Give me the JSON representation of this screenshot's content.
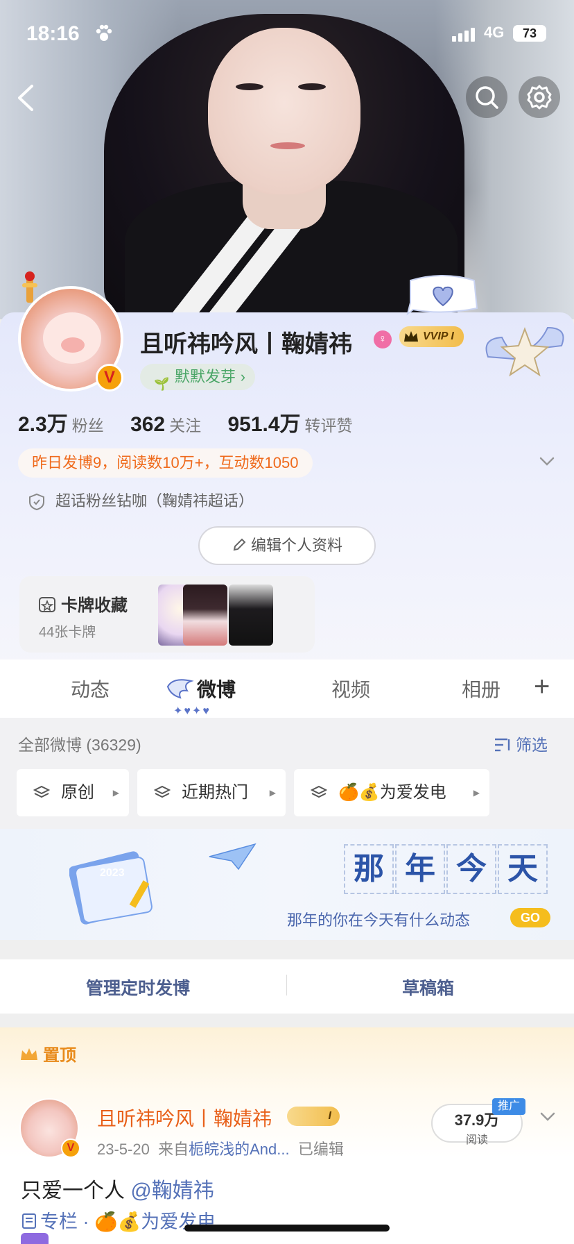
{
  "status": {
    "time": "18:16",
    "network": "4G",
    "battery": "73"
  },
  "profile": {
    "name": "且听祎吟风丨鞠婧祎",
    "vip_label": "VVIP I",
    "sprout_label": "默默发芽",
    "stats": [
      {
        "value": "2.3万",
        "label": "粉丝"
      },
      {
        "value": "362",
        "label": "关注"
      },
      {
        "value": "951.4万",
        "label": "转评赞"
      }
    ],
    "daily_summary": "昨日发博9，阅读数10万+，互动数1050",
    "superchat": "超话粉丝钻咖（鞠婧祎超话）",
    "edit_label": "编辑个人资料"
  },
  "cards": {
    "title": "卡牌收藏",
    "count": "44张卡牌"
  },
  "tabs": {
    "items": [
      "动态",
      "微博",
      "视频",
      "相册"
    ],
    "active": "微博"
  },
  "filter": {
    "all_label": "全部微博 (36329)",
    "filter_label": "筛选",
    "chips": [
      "原创",
      "近期热门",
      "🍊💰为爱发电"
    ]
  },
  "banner": {
    "chars": [
      "那",
      "年",
      "今",
      "天"
    ],
    "subtitle": "那年的你在今天有什么动态",
    "go": "GO",
    "calendar_year": "2023"
  },
  "manage": {
    "scheduled": "管理定时发博",
    "drafts": "草稿箱"
  },
  "post": {
    "pinned_label": "置顶",
    "author": "且听祎吟风丨鞠婧祎",
    "badge": "I",
    "meta_date": "23-5-20",
    "meta_from": "来自",
    "meta_source": "栀皖浅的And...",
    "meta_edited": "已编辑",
    "reads": "37.9万",
    "reads_label": "阅读",
    "promo": "推广",
    "text": "只爱一个人",
    "mention": "@鞠婧祎",
    "tags": "专栏 · 🍊💰为爱发电"
  },
  "colors": {
    "accent_orange": "#ef6a1c",
    "link_blue": "#5572b8",
    "vip_gold": "#f2bd4c"
  }
}
